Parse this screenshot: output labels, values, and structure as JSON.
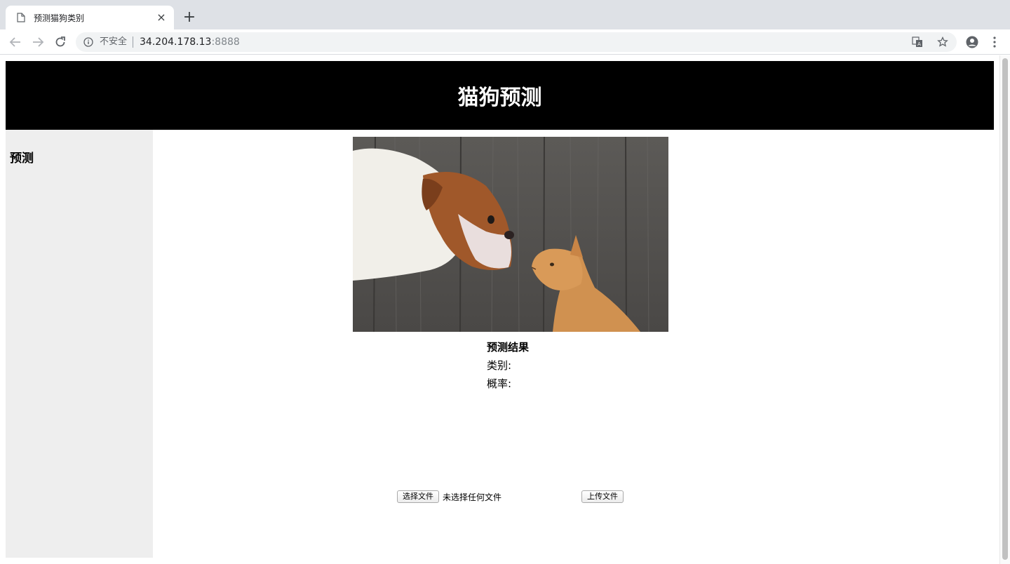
{
  "browser": {
    "tab_title": "预测猫狗类别",
    "tab_close": "×",
    "new_tab": "+",
    "security_label": "不安全",
    "url_host": "34.204.178.13",
    "url_port": ":8888"
  },
  "header": {
    "title": "猫狗预测"
  },
  "sidebar": {
    "items": [
      {
        "label": "预测"
      }
    ]
  },
  "image": {
    "alt": "dog and cat facing each other in front of wooden fence"
  },
  "result": {
    "title": "预测结果",
    "category_label": "类别:",
    "probability_label": "概率:"
  },
  "upload": {
    "choose_button": "选择文件",
    "no_file_text": "未选择任何文件",
    "submit_button": "上传文件"
  }
}
